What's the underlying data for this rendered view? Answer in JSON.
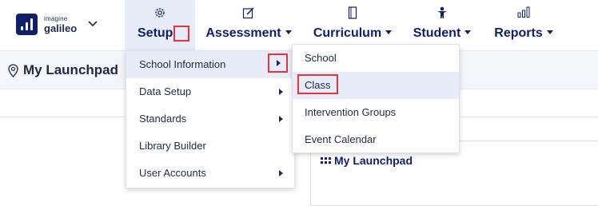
{
  "logo": {
    "small_text": "imagine",
    "big_text": "galileo"
  },
  "nav": {
    "setup": "Setup",
    "assessment": "Assessment",
    "curriculum": "Curriculum",
    "student": "Student",
    "reports": "Reports"
  },
  "icons": {
    "setup": "gear-icon",
    "assessment": "pencil-square-icon",
    "curriculum": "notebook-icon",
    "student": "person-icon",
    "reports": "bar-chart-icon",
    "page_title": "location-pin-icon",
    "launchpad": "grid-dots-icon"
  },
  "page": {
    "title": "My Launchpad"
  },
  "setup_menu": {
    "items": [
      {
        "label": "School Information",
        "has_submenu": true
      },
      {
        "label": "Data Setup",
        "has_submenu": true
      },
      {
        "label": "Standards",
        "has_submenu": true
      },
      {
        "label": "Library Builder",
        "has_submenu": false
      },
      {
        "label": "User Accounts",
        "has_submenu": true
      }
    ]
  },
  "school_menu": {
    "items": [
      {
        "label": "School"
      },
      {
        "label": "Class"
      },
      {
        "label": "Intervention Groups"
      },
      {
        "label": "Event Calendar"
      }
    ]
  },
  "launchpad_card": {
    "title": "My Launchpad"
  },
  "colors": {
    "brand_navy": "#0f1f6b",
    "highlight_red": "#e5343d",
    "active_bg": "#e7ecf8"
  }
}
